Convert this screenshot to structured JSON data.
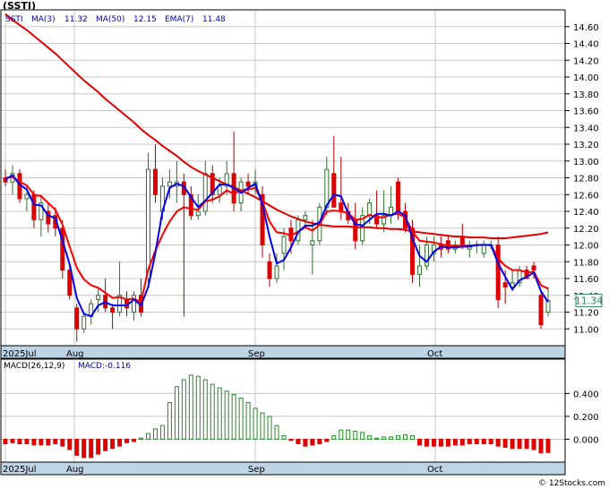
{
  "header": {
    "title": "(SSTI)"
  },
  "price_legend": {
    "ticker": "SSTI",
    "ma3_label": "MA(3)",
    "ma3_value": "11.32",
    "ma50_label": "MA(50)",
    "ma50_value": "12.15",
    "ema7_label": "EMA(7)",
    "ema7_value": "11.48"
  },
  "macd_legend": {
    "label": "MACD(26,12,9)",
    "value_label": "MACD:-0.116"
  },
  "last_price_tag": "11.34",
  "x_axis": {
    "labels": [
      "2025Jul",
      "Aug",
      "Sep",
      "Oct"
    ]
  },
  "watermark": "© 12Stocks.com",
  "colors": {
    "up": "#228b22",
    "down": "#dd0000",
    "ma3": "#0000ee",
    "ma50": "#e00000",
    "ema7": "#ff0000",
    "axis_band": "#bcd4e4",
    "grid": "#c8c8c8",
    "tag": "#2e8b57"
  },
  "chart_data": [
    {
      "type": "candlestick",
      "title": "(SSTI)",
      "ylim": [
        10.8,
        14.8
      ],
      "y_ticks": [
        "11.00",
        "11.20",
        "11.40",
        "11.60",
        "11.80",
        "12.00",
        "12.20",
        "12.40",
        "12.60",
        "12.80",
        "13.00",
        "13.20",
        "13.40",
        "13.60",
        "13.80",
        "14.00",
        "14.20",
        "14.40",
        "14.60"
      ],
      "candles": [
        [
          12.8,
          12.9,
          12.7,
          12.75
        ],
        [
          12.75,
          12.95,
          12.6,
          12.85
        ],
        [
          12.85,
          12.9,
          12.5,
          12.55
        ],
        [
          12.55,
          12.7,
          12.4,
          12.6
        ],
        [
          12.6,
          12.65,
          12.2,
          12.3
        ],
        [
          12.3,
          12.6,
          12.1,
          12.5
        ],
        [
          12.4,
          12.5,
          12.15,
          12.25
        ],
        [
          12.35,
          12.45,
          12.1,
          12.2
        ],
        [
          12.2,
          12.3,
          11.6,
          11.7
        ],
        [
          11.7,
          11.75,
          11.35,
          11.4
        ],
        [
          11.25,
          11.3,
          10.85,
          11.0
        ],
        [
          11.0,
          11.2,
          10.95,
          11.15
        ],
        [
          11.15,
          11.35,
          11.05,
          11.3
        ],
        [
          11.35,
          11.5,
          11.2,
          11.4
        ],
        [
          11.4,
          11.6,
          11.2,
          11.25
        ],
        [
          11.25,
          11.3,
          11.0,
          11.2
        ],
        [
          11.2,
          11.8,
          11.15,
          11.4
        ],
        [
          11.35,
          11.45,
          11.15,
          11.25
        ],
        [
          11.2,
          11.45,
          11.1,
          11.4
        ],
        [
          11.4,
          11.6,
          11.15,
          11.2
        ],
        [
          11.6,
          13.1,
          11.55,
          12.9
        ],
        [
          12.9,
          13.2,
          12.5,
          12.6
        ],
        [
          12.4,
          12.8,
          12.3,
          12.7
        ],
        [
          12.7,
          12.9,
          12.55,
          12.75
        ],
        [
          12.7,
          13.0,
          12.5,
          12.75
        ],
        [
          12.75,
          12.85,
          11.15,
          12.6
        ],
        [
          12.6,
          12.7,
          12.3,
          12.35
        ],
        [
          12.35,
          12.6,
          12.3,
          12.4
        ],
        [
          12.4,
          13.0,
          12.35,
          12.85
        ],
        [
          12.85,
          12.95,
          12.5,
          12.6
        ],
        [
          12.6,
          12.8,
          12.5,
          12.7
        ],
        [
          12.7,
          13.0,
          12.6,
          12.85
        ],
        [
          12.85,
          13.35,
          12.4,
          12.5
        ],
        [
          12.5,
          12.8,
          12.4,
          12.75
        ],
        [
          12.75,
          12.85,
          12.6,
          12.7
        ],
        [
          12.7,
          12.9,
          12.6,
          12.75
        ],
        [
          12.6,
          12.7,
          11.85,
          12.0
        ],
        [
          11.8,
          11.9,
          11.5,
          11.6
        ],
        [
          11.6,
          11.9,
          11.55,
          11.75
        ],
        [
          11.9,
          12.2,
          11.7,
          12.1
        ],
        [
          12.2,
          12.3,
          11.9,
          12.05
        ],
        [
          12.05,
          12.35,
          12.0,
          12.3
        ],
        [
          12.3,
          12.4,
          12.2,
          12.35
        ],
        [
          12.0,
          12.3,
          11.65,
          12.05
        ],
        [
          12.05,
          12.5,
          12.0,
          12.45
        ],
        [
          12.45,
          13.05,
          12.35,
          12.9
        ],
        [
          12.85,
          13.3,
          12.6,
          12.45
        ],
        [
          12.5,
          13.05,
          12.3,
          12.4
        ],
        [
          12.4,
          12.5,
          12.25,
          12.3
        ],
        [
          12.3,
          12.5,
          11.95,
          12.05
        ],
        [
          12.05,
          12.45,
          12.0,
          12.35
        ],
        [
          12.35,
          12.55,
          12.25,
          12.5
        ],
        [
          12.35,
          12.65,
          12.2,
          12.25
        ],
        [
          12.25,
          12.65,
          12.15,
          12.35
        ],
        [
          12.35,
          12.7,
          12.25,
          12.45
        ],
        [
          12.75,
          12.8,
          12.3,
          12.4
        ],
        [
          12.4,
          12.5,
          12.15,
          12.2
        ],
        [
          12.2,
          12.3,
          11.55,
          11.65
        ],
        [
          11.65,
          12.0,
          11.5,
          11.75
        ],
        [
          11.75,
          12.1,
          11.7,
          12.0
        ],
        [
          11.9,
          12.1,
          11.8,
          12.0
        ],
        [
          12.0,
          12.1,
          11.85,
          11.95
        ],
        [
          12.05,
          12.1,
          11.9,
          11.95
        ],
        [
          11.95,
          12.05,
          11.9,
          12.0
        ],
        [
          12.1,
          12.25,
          11.95,
          12.0
        ],
        [
          11.95,
          12.05,
          11.85,
          12.0
        ],
        [
          12.0,
          12.05,
          11.9,
          12.0
        ],
        [
          11.9,
          12.05,
          11.85,
          12.0
        ],
        [
          12.0,
          12.05,
          11.95,
          12.0
        ],
        [
          12.0,
          12.1,
          11.25,
          11.35
        ],
        [
          11.55,
          11.7,
          11.3,
          11.5
        ],
        [
          11.5,
          11.7,
          11.45,
          11.55
        ],
        [
          11.55,
          11.75,
          11.5,
          11.7
        ],
        [
          11.7,
          11.75,
          11.6,
          11.6
        ],
        [
          11.75,
          11.8,
          11.6,
          11.7
        ],
        [
          11.4,
          11.45,
          11.0,
          11.05
        ],
        [
          11.2,
          11.5,
          11.15,
          11.34
        ]
      ],
      "ma3": [
        12.78,
        12.83,
        12.72,
        12.66,
        12.48,
        12.47,
        12.35,
        12.32,
        12.05,
        11.77,
        11.37,
        11.18,
        11.15,
        11.28,
        11.32,
        11.28,
        11.28,
        11.28,
        11.35,
        11.28,
        11.5,
        11.9,
        12.4,
        12.68,
        12.73,
        12.7,
        12.57,
        12.45,
        12.53,
        12.62,
        12.72,
        12.72,
        12.68,
        12.62,
        12.68,
        12.73,
        12.48,
        12.1,
        11.78,
        11.82,
        11.97,
        12.15,
        12.23,
        12.23,
        12.27,
        12.47,
        12.6,
        12.58,
        12.38,
        12.25,
        12.23,
        12.3,
        12.37,
        12.37,
        12.35,
        12.4,
        12.35,
        12.08,
        11.87,
        11.8,
        11.92,
        11.98,
        11.97,
        11.97,
        11.98,
        11.98,
        12.0,
        12.0,
        12.0,
        11.78,
        11.62,
        11.47,
        11.58,
        11.62,
        11.67,
        11.45,
        11.32
      ],
      "ma50": [
        14.75,
        14.68,
        14.62,
        14.56,
        14.49,
        14.42,
        14.35,
        14.28,
        14.2,
        14.12,
        14.04,
        13.96,
        13.89,
        13.82,
        13.74,
        13.67,
        13.6,
        13.53,
        13.46,
        13.38,
        13.31,
        13.25,
        13.18,
        13.12,
        13.06,
        12.99,
        12.93,
        12.88,
        12.84,
        12.8,
        12.76,
        12.72,
        12.69,
        12.65,
        12.61,
        12.57,
        12.52,
        12.47,
        12.42,
        12.38,
        12.34,
        12.31,
        12.28,
        12.26,
        12.24,
        12.23,
        12.22,
        12.22,
        12.22,
        12.21,
        12.21,
        12.21,
        12.2,
        12.2,
        12.19,
        12.19,
        12.18,
        12.16,
        12.15,
        12.14,
        12.13,
        12.12,
        12.11,
        12.1,
        12.1,
        12.09,
        12.09,
        12.09,
        12.08,
        12.08,
        12.08,
        12.09,
        12.1,
        12.11,
        12.12,
        12.13,
        12.15
      ],
      "ema7": [
        12.8,
        12.81,
        12.75,
        12.71,
        12.6,
        12.58,
        12.5,
        12.42,
        12.24,
        11.98,
        11.73,
        11.59,
        11.52,
        11.49,
        11.43,
        11.37,
        11.38,
        11.35,
        11.36,
        11.32,
        11.71,
        11.93,
        12.12,
        12.28,
        12.4,
        12.45,
        12.43,
        12.42,
        12.52,
        12.54,
        12.58,
        12.65,
        12.61,
        12.65,
        12.66,
        12.68,
        12.51,
        12.28,
        12.15,
        12.14,
        12.11,
        12.16,
        12.21,
        12.17,
        12.24,
        12.4,
        12.41,
        12.4,
        12.38,
        12.3,
        12.31,
        12.36,
        12.33,
        12.33,
        12.36,
        12.37,
        12.33,
        12.16,
        12.05,
        12.04,
        12.03,
        12.01,
        11.99,
        11.99,
        11.99,
        11.99,
        12.0,
        12.0,
        12.0,
        11.84,
        11.75,
        11.7,
        11.7,
        11.67,
        11.68,
        11.52,
        11.48
      ]
    },
    {
      "type": "bar",
      "title": "MACD(26,12,9)",
      "ylim": [
        -0.2,
        0.7
      ],
      "y_ticks": [
        "0.000",
        "0.200",
        "0.400"
      ],
      "values": [
        -0.04,
        -0.03,
        -0.04,
        -0.04,
        -0.05,
        -0.05,
        -0.05,
        -0.04,
        -0.06,
        -0.09,
        -0.14,
        -0.16,
        -0.16,
        -0.13,
        -0.1,
        -0.08,
        -0.06,
        -0.03,
        -0.02,
        0.01,
        0.05,
        0.09,
        0.12,
        0.32,
        0.46,
        0.52,
        0.56,
        0.55,
        0.52,
        0.48,
        0.45,
        0.42,
        0.39,
        0.36,
        0.32,
        0.27,
        0.23,
        0.2,
        0.12,
        0.03,
        -0.01,
        -0.04,
        -0.06,
        -0.05,
        -0.04,
        -0.02,
        0.03,
        0.08,
        0.08,
        0.07,
        0.06,
        0.03,
        0.01,
        0.02,
        0.02,
        0.03,
        0.04,
        0.03,
        -0.05,
        -0.06,
        -0.06,
        -0.06,
        -0.06,
        -0.05,
        -0.05,
        -0.04,
        -0.04,
        -0.04,
        -0.04,
        -0.06,
        -0.07,
        -0.08,
        -0.08,
        -0.08,
        -0.09,
        -0.12,
        -0.116
      ]
    }
  ]
}
